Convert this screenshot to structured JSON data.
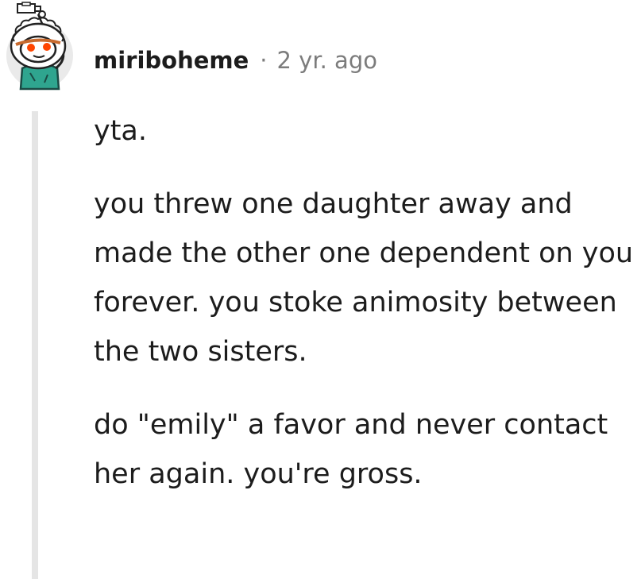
{
  "comment": {
    "username": "miriboheme",
    "separator": "·",
    "timestamp": "2 yr. ago",
    "avatar_icon": "snoo-avatar-icon",
    "paragraphs": [
      "yta.",
      "you threw one daughter away and made the other one dependent on you forever. you stoke animosity between the two sisters.",
      "do \"emily\" a favor and never contact her again. you're gross."
    ]
  },
  "colors": {
    "text": "#1c1c1c",
    "meta": "#7c7c7c",
    "thread_line": "#e5e5e5",
    "avatar_bg": "#eaeaea",
    "avatar_shirt": "#2fa58f"
  }
}
